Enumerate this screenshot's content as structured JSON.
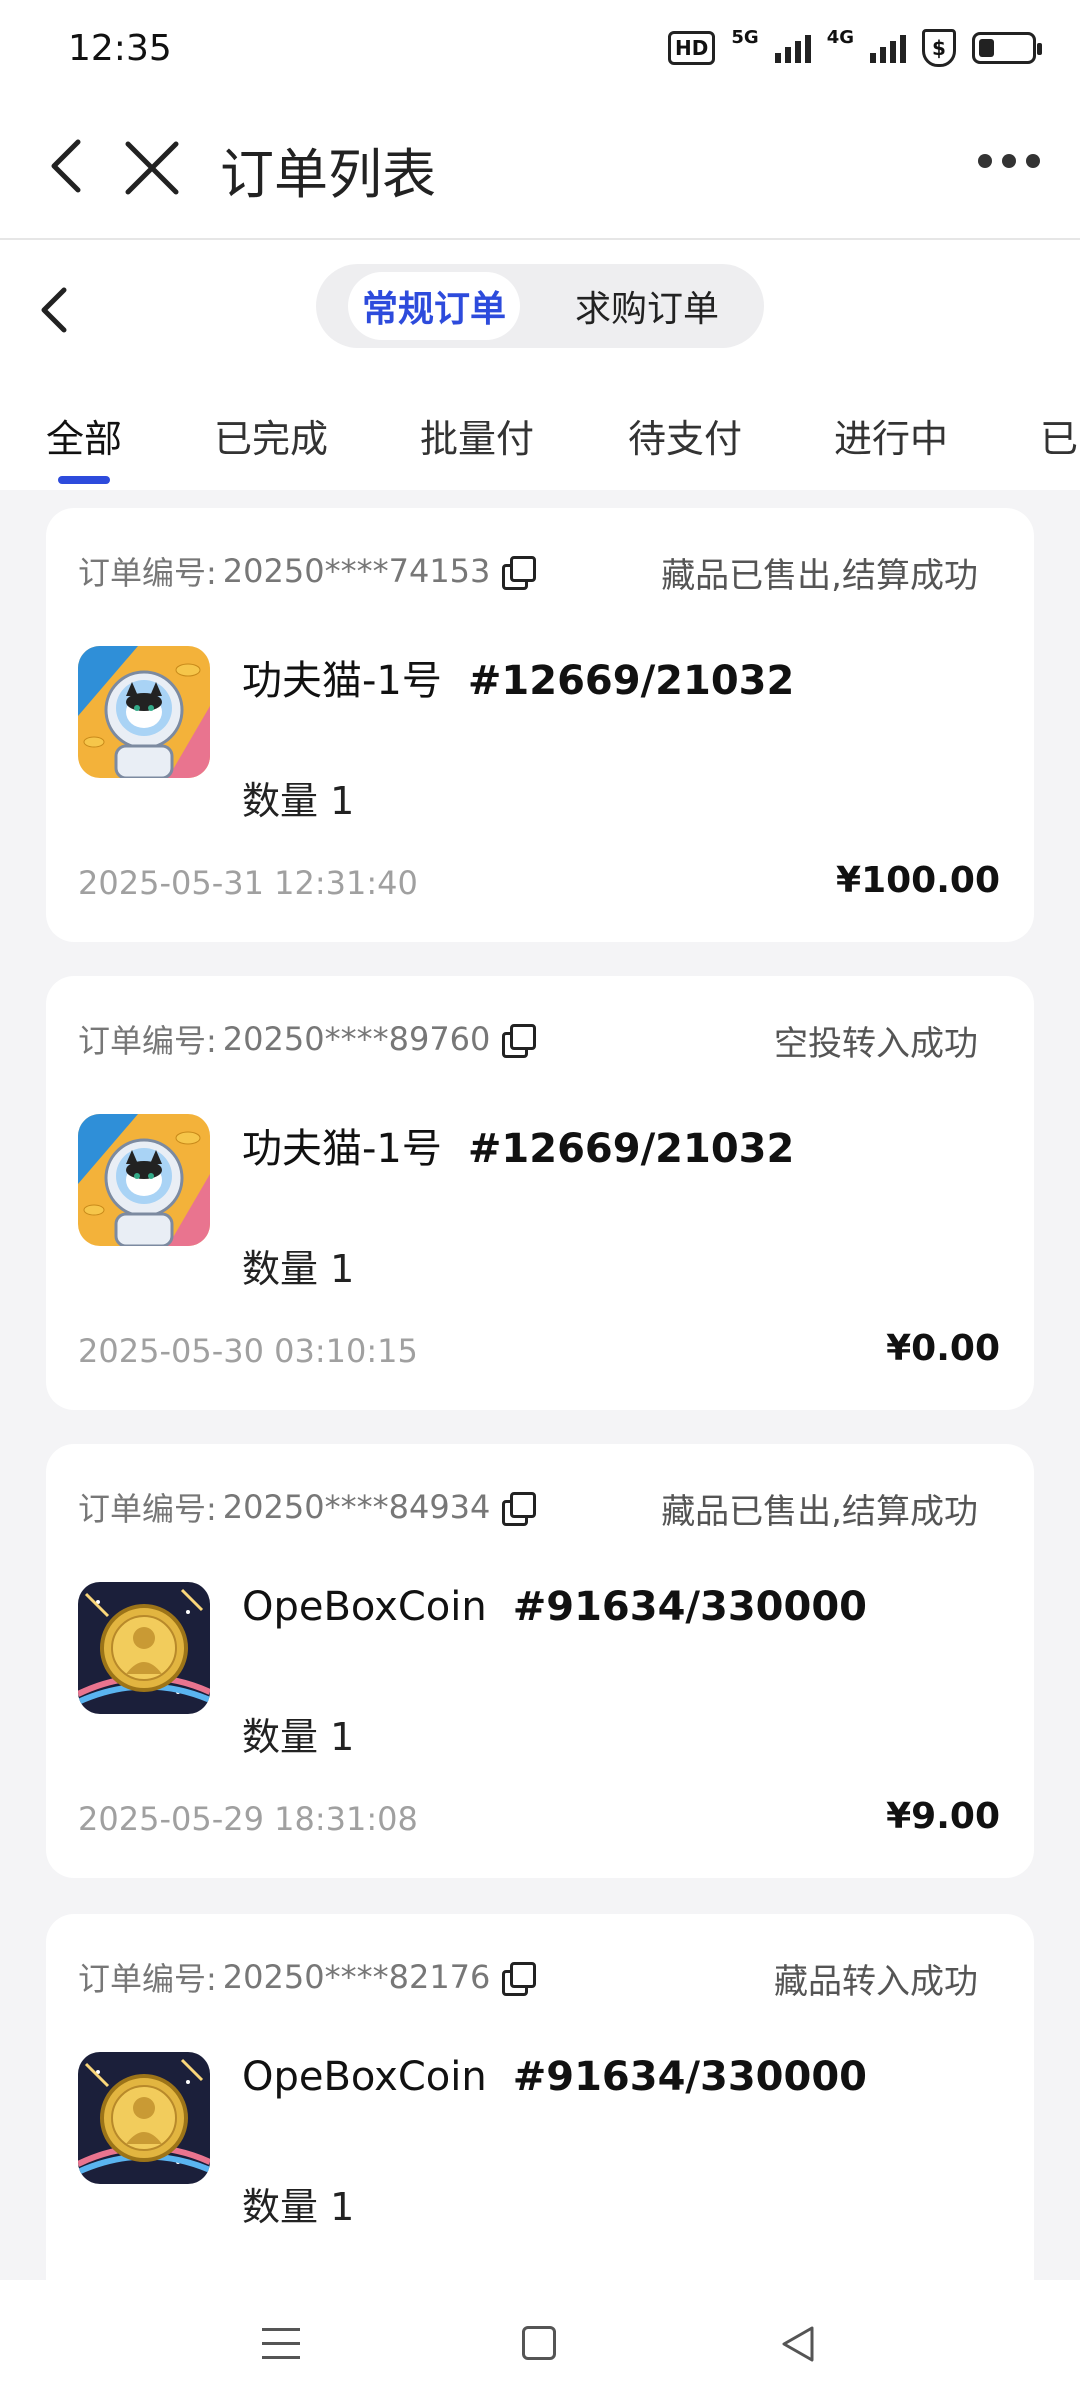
{
  "status_bar": {
    "time": "12:35",
    "hd": "HD",
    "net_5g": "5G",
    "net_4g": "4G",
    "battery_level": 0.3,
    "shield_glyph": "$"
  },
  "header": {
    "title": "订单列表",
    "back_icon": "chevron-left-icon",
    "close_icon": "close-icon",
    "more_icon": "more-horizontal-icon"
  },
  "segment": {
    "options": [
      "常规订单",
      "求购订单"
    ],
    "selected": "常规订单"
  },
  "tabs": {
    "items": [
      "全部",
      "已完成",
      "批量付",
      "待支付",
      "进行中",
      "已"
    ],
    "selected": "全部"
  },
  "orders": [
    {
      "order_label": "订单编号:",
      "order_no": "20250****74153",
      "status": "藏品已售出,结算成功",
      "name": "功夫猫-1号",
      "serial": "#12669/21032",
      "qty": "数量 1",
      "time": "2025-05-31 12:31:40",
      "price": "¥100.00",
      "thumb": "cat-astronaut-image"
    },
    {
      "order_label": "订单编号:",
      "order_no": "20250****89760",
      "status": "空投转入成功",
      "name": "功夫猫-1号",
      "serial": "#12669/21032",
      "qty": "数量 1",
      "time": "2025-05-30 03:10:15",
      "price": "¥0.00",
      "thumb": "cat-astronaut-image"
    },
    {
      "order_label": "订单编号:",
      "order_no": "20250****84934",
      "status": "藏品已售出,结算成功",
      "name": "OpeBoxCoin",
      "serial": "#91634/330000",
      "qty": "数量 1",
      "time": "2025-05-29 18:31:08",
      "price": "¥9.00",
      "thumb": "gold-coin-image"
    },
    {
      "order_label": "订单编号:",
      "order_no": "20250****82176",
      "status": "藏品转入成功",
      "name": "OpeBoxCoin",
      "serial": "#91634/330000",
      "qty": "数量 1",
      "time": "",
      "price": "",
      "thumb": "gold-coin-image"
    }
  ],
  "colors": {
    "accent": "#2d4bdc",
    "background": "#f4f4f6",
    "muted_text": "#a0a0a0"
  }
}
